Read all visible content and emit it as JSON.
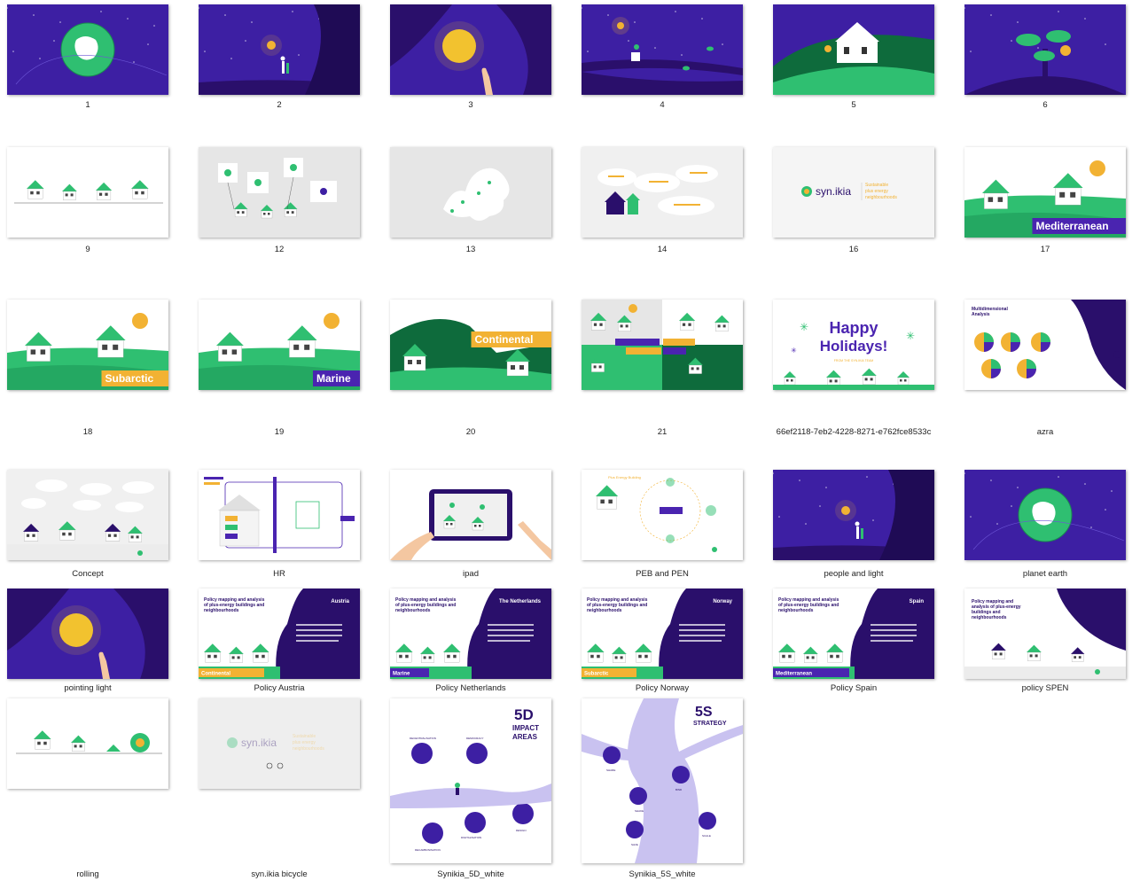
{
  "files": [
    {
      "name": "1",
      "kind": "planet",
      "col": 0,
      "row": 0
    },
    {
      "name": "2",
      "kind": "night-person",
      "col": 1,
      "row": 0
    },
    {
      "name": "3",
      "kind": "night-moon-hand",
      "col": 2,
      "row": 0
    },
    {
      "name": "4",
      "kind": "night-branch",
      "col": 3,
      "row": 0
    },
    {
      "name": "5",
      "kind": "green-house",
      "col": 4,
      "row": 0
    },
    {
      "name": "6",
      "kind": "night-tree",
      "col": 5,
      "row": 0
    },
    {
      "name": "9",
      "kind": "white-houses",
      "col": 0,
      "row": 1
    },
    {
      "name": "12",
      "kind": "grey-scene",
      "col": 1,
      "row": 1
    },
    {
      "name": "13",
      "kind": "grey-map",
      "col": 2,
      "row": 1
    },
    {
      "name": "14",
      "kind": "grey-clouds",
      "col": 3,
      "row": 1
    },
    {
      "name": "16",
      "kind": "logo-card",
      "col": 4,
      "row": 1
    },
    {
      "name": "17",
      "kind": "region",
      "col": 5,
      "row": 1,
      "label": "Mediterranean",
      "labelBg": "#4a24b0"
    },
    {
      "name": "18",
      "kind": "region",
      "col": 0,
      "row": 2,
      "label": "Subarctic",
      "labelBg": "#f2b233"
    },
    {
      "name": "19",
      "kind": "region",
      "col": 1,
      "row": 2,
      "label": "Marine",
      "labelBg": "#4a24b0"
    },
    {
      "name": "20",
      "kind": "region-dark",
      "col": 2,
      "row": 2,
      "label": "Continental",
      "labelBg": "#f2b233"
    },
    {
      "name": "21",
      "kind": "four-regions",
      "col": 3,
      "row": 2
    },
    {
      "name": "66ef2118-7eb2-4228-8271-e762fce8533c",
      "kind": "holidays",
      "col": 4,
      "row": 2,
      "title": "Happy Holidays!",
      "sub": "FROM THE SYN.IKIA TEAM"
    },
    {
      "name": "azra",
      "kind": "pies",
      "col": 5,
      "row": 2,
      "title": "Multidimensional Analysis"
    },
    {
      "name": "Concept",
      "kind": "concept",
      "col": 0,
      "row": 3
    },
    {
      "name": "HR",
      "kind": "hr",
      "col": 1,
      "row": 3
    },
    {
      "name": "ipad",
      "kind": "ipad",
      "col": 2,
      "row": 3
    },
    {
      "name": "PEB and PEN",
      "kind": "peb",
      "col": 3,
      "row": 3
    },
    {
      "name": "people and light",
      "kind": "night-person",
      "col": 4,
      "row": 3
    },
    {
      "name": "planet earth",
      "kind": "planet",
      "col": 5,
      "row": 3
    },
    {
      "name": "pointing light",
      "kind": "night-moon-hand",
      "col": 0,
      "row": 4
    },
    {
      "name": "Policy Austria",
      "kind": "policy",
      "col": 1,
      "row": 4,
      "country": "Austria",
      "tag": "Continental",
      "tagBg": "#f2b233"
    },
    {
      "name": "Policy Netherlands",
      "kind": "policy",
      "col": 2,
      "row": 4,
      "country": "The Netherlands",
      "tag": "Marine",
      "tagBg": "#4a24b0"
    },
    {
      "name": "Policy Norway",
      "kind": "policy",
      "col": 3,
      "row": 4,
      "country": "Norway",
      "tag": "Subarctic",
      "tagBg": "#f2b233"
    },
    {
      "name": "Policy Spain",
      "kind": "policy",
      "col": 4,
      "row": 4,
      "country": "Spain",
      "tag": "Mediterranean",
      "tagBg": "#4a24b0"
    },
    {
      "name": "policy SPEN",
      "kind": "policy-spen",
      "col": 5,
      "row": 4
    },
    {
      "name": "rolling",
      "kind": "rolling",
      "col": 0,
      "row": 5
    },
    {
      "name": "syn.ikia bicycle",
      "kind": "logo-faded",
      "col": 1,
      "row": 5
    },
    {
      "name": "Synikia_5D_white",
      "kind": "tall-5d",
      "col": 2,
      "row": 5,
      "title": "5D IMPACT AREAS"
    },
    {
      "name": "Synikia_5S_white",
      "kind": "tall-5s",
      "col": 3,
      "row": 5,
      "title": "5S STRATEGY"
    }
  ],
  "policy_heading": "Policy mapping and analysis of plus-energy buildings and neighbourhoods",
  "logo_text": "syn.ikia",
  "logo_sub": "Sustainable plus energy neighbourhoods",
  "colors": {
    "purple": "#3d1fa3",
    "deep": "#2a0f6b",
    "green": "#2fbf71",
    "darkgreen": "#0e6b3c",
    "yellow": "#f2b233",
    "grey": "#e6e6e6"
  }
}
